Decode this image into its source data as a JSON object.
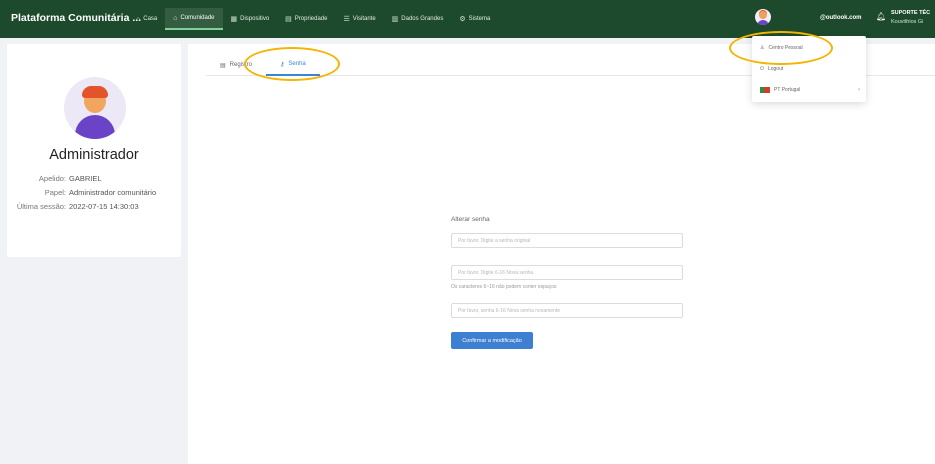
{
  "topbar": {
    "brand": "Plataforma Comunitária ...",
    "nav": [
      {
        "label": "Casa",
        "icon": "home-icon",
        "glyph": "⌂",
        "active": false
      },
      {
        "label": "Comunidade",
        "icon": "community-icon",
        "glyph": "⌂",
        "active": true
      },
      {
        "label": "Dispositivo",
        "icon": "device-icon",
        "glyph": "▦",
        "active": false
      },
      {
        "label": "Propriedade",
        "icon": "property-icon",
        "glyph": "▤",
        "active": false
      },
      {
        "label": "Visitante",
        "icon": "visitor-icon",
        "glyph": "☰",
        "active": false
      },
      {
        "label": "Dados Grandes",
        "icon": "chart-icon",
        "glyph": "▥",
        "active": false
      },
      {
        "label": "Sistema",
        "icon": "settings-icon",
        "glyph": "⚙",
        "active": false
      }
    ],
    "user_email": "@outlook.com",
    "support_title": "SUPORTE TÉC",
    "support_sub": "Kouvithios Gi"
  },
  "profile": {
    "name": "Administrador",
    "fields": [
      {
        "label": "Apelido:",
        "value": "GABRIEL"
      },
      {
        "label": "Papel:",
        "value": "Administrador comunitário"
      },
      {
        "label": "Última sessão:",
        "value": "2022-07-15 14:30:03"
      }
    ]
  },
  "tabs": [
    {
      "label": "Registro",
      "active": false
    },
    {
      "label": "Senha",
      "active": true
    }
  ],
  "form": {
    "title": "Alterar senha",
    "current_placeholder": "Por favor, Digite a senha original",
    "new_placeholder": "Por favor, Digite 6-16 Nova senha",
    "hint": "Os caracteres 6~16 não podem conter espaços",
    "confirm_placeholder": "Por favor, senha 6-16 Nova senha novamente",
    "submit_label": "Confirmar a modificação"
  },
  "dropdown": {
    "items": [
      {
        "label": "Centro Pessoal",
        "icon": "user-icon"
      },
      {
        "label": "Logout",
        "icon": "logout-icon"
      },
      {
        "label": "PT Portugal",
        "icon": "flag-icon"
      }
    ]
  },
  "colors": {
    "topbar": "#1d4a2c",
    "accent": "#3a86d4",
    "button": "#3d7fd1",
    "highlight": "#f5b400"
  }
}
